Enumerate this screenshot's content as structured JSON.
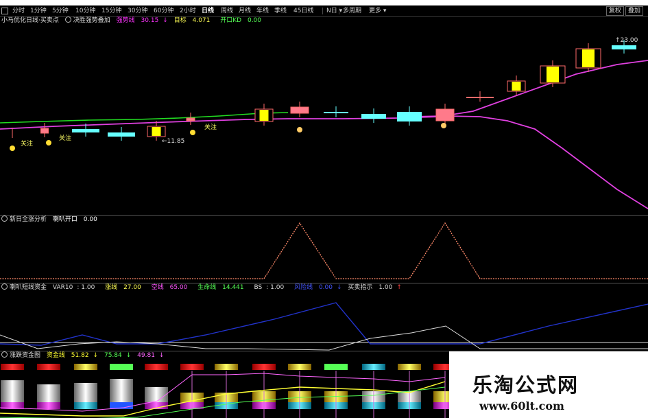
{
  "toolbar": {
    "items": [
      "分时",
      "1分钟",
      "5分钟",
      "10分钟",
      "15分钟",
      "30分钟",
      "60分钟",
      "2小时",
      "日线",
      "周线",
      "月线",
      "年线",
      "季线",
      "45日线",
      "多周期"
    ],
    "more_label": "更多",
    "active_item": "日线",
    "right_buttons": [
      "复权",
      "叠加"
    ]
  },
  "main_panel": {
    "indicator_title": "小马优化日线·买卖点",
    "formula_name": "决胜强势叠加",
    "legend": [
      {
        "label": "强势线",
        "value": "30.15",
        "color": "#ff33ff"
      },
      {
        "label": "目标",
        "value": "4.071",
        "color": "#ffff55"
      },
      {
        "label": "开口KD",
        "value": "0.00",
        "color": "#55ff55"
      }
    ],
    "price_high_label": "23.00",
    "price_low_label": "11.85",
    "annotations": [
      "关注",
      "关注",
      "关注"
    ]
  },
  "panel2": {
    "title": "新日全涨分析",
    "legend": [
      {
        "label": "喇叭开口",
        "value": "0.00",
        "color": "#ffffff"
      }
    ]
  },
  "panel3": {
    "title": "喇叭短线资金",
    "legend": [
      {
        "label": "VAR10",
        "value": "1.00",
        "color": "#dddddd"
      },
      {
        "label": "涨线",
        "value": "27.00",
        "color": "#ffff55"
      },
      {
        "label": "空线",
        "value": "65.00",
        "color": "#ff55ff"
      },
      {
        "label": "生命线",
        "value": "14.441",
        "color": "#55ff55"
      },
      {
        "label": "BS",
        "value": "1.00",
        "color": "#dddddd"
      },
      {
        "label": "风险线",
        "value": "0.00",
        "color": "#4455ff"
      },
      {
        "label": "买卖指示",
        "value": "1.00",
        "color": "#dddddd"
      }
    ]
  },
  "panel4": {
    "title": "涨跌资金图",
    "legend": [
      {
        "label": "资金线",
        "value": "51.82",
        "color": "#ffff33"
      },
      {
        "label": "",
        "value": "75.84",
        "color": "#55ff55"
      },
      {
        "label": "",
        "value": "49.81",
        "color": "#ff66ff"
      }
    ]
  },
  "watermark": {
    "line1": "乐淘公式网",
    "line2": "www.60lt.com"
  },
  "colors": {
    "candle_up": "#ffff00",
    "candle_up_border": "#ff6a6a",
    "candle_down": "#66ffff",
    "magenta_line": "#e040e0",
    "green_line": "#22dd22",
    "zigzag": "#ff8a6a",
    "blue_line": "#2233cc"
  },
  "chart_data": {
    "type": "candlestick",
    "candles": [
      {
        "kind": "flat"
      },
      {
        "kind": "pink"
      },
      {
        "kind": "cyan"
      },
      {
        "kind": "cyan"
      },
      {
        "kind": "yellow"
      },
      {
        "kind": "pink"
      },
      {
        "kind": "yellow"
      },
      {
        "kind": "pink"
      },
      {
        "kind": "cyan"
      },
      {
        "kind": "cyan"
      },
      {
        "kind": "cyan"
      },
      {
        "kind": "pink"
      },
      {
        "kind": "flat"
      },
      {
        "kind": "yellow"
      },
      {
        "kind": "yellow"
      },
      {
        "kind": "yellow"
      },
      {
        "kind": "cyan"
      }
    ]
  }
}
